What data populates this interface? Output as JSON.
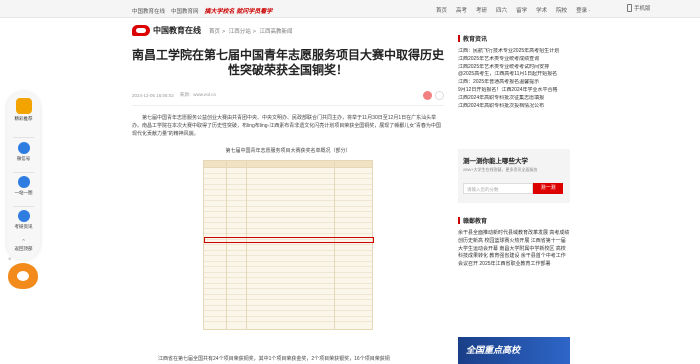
{
  "topbar": {
    "links": [
      "中国教育在线",
      "中国教育网"
    ],
    "slogan": "搞大学校名 就问学员看学",
    "nav": [
      "首页",
      "高考",
      "考研",
      "四六",
      "留学",
      "学术",
      "院校",
      "登录 ·"
    ],
    "login_icon": "mobile-icon",
    "mobile_label": "手机版"
  },
  "header": {
    "logo_text": "中国教育在线",
    "breadcrumb": [
      "首页",
      "江西分站",
      "江西高教新闻"
    ]
  },
  "left_dock": {
    "items": [
      {
        "label": "精彩推荐",
        "icon": "gift-icon"
      },
      {
        "label": "微信号",
        "icon": "wechat-icon"
      },
      {
        "label": "一站一图",
        "icon": "book-icon"
      },
      {
        "label": "考研资讯",
        "icon": "news-icon"
      },
      {
        "label": "返回顶部",
        "icon": "arrow-up-icon"
      }
    ],
    "close_label": "×"
  },
  "article": {
    "title": "南昌工学院在第七届中国青年志愿服务项目大赛中取得历史性突破荣获全国铜奖！",
    "date": "2024-12-05 16:05:02",
    "source": "来源：www.eol.cn",
    "para1": "第七届中国青年志愿服务公益创业大赛由共青团中央、中央文明办、民政部联合门共同主办，将举于11月30日至12月1日在广东汕头举办。南昌工学院在本次大赛中取得了历史性突破，布ling布ling-江西素布青非遗文化闪亮计划项目荣获全国铜奖，展现了赣鄱儿女“青春为中国现代化贡献力量”的精神风貌。",
    "caption": "第七届中国青年志愿服务项目大赛获奖名单概况（部分）",
    "lower": "江西省在第七届全国共有24个项目荣获铜奖，其中1个项目荣获金奖，2个项目荣获银奖，16个项目荣获铜"
  },
  "sidebar": {
    "heading": "教育资讯",
    "news": [
      "江西：民航飞行技术专业2025年高考招生计划",
      "江西2025年艺术类专业统考成绩查询",
      "江西2025年艺术类专业统考考试时间安排",
      "@2025高考生，江西高考11月1日起开始报名",
      "江西：2025年普通高考报名温馨提示",
      "9月12日开始报名！江西2024年学业水平合格",
      "江西2024年高职专科批次征集志愿填报",
      "江西2024年高职专科批次投档情况公布"
    ],
    "search_title": "测一测你能上哪些大学",
    "search_sub": "28W+大学生在线答疑，更多资讯全面服务",
    "search_placeholder": "请输入您的分数",
    "search_button": "测一测",
    "heading2": "赣鄱教育",
    "news2": "余干县全面推动新时代县域教育改革发展 高考成绩创历史新高 校园篮球赛火热开展 江西省第十一届大学生运动会开幕 南昌大学附属中学新校区 高校科技成果转化 教育强省建设 余干县首个中考工作会议召开 2025年江西省职业教育工作部署",
    "banner": "全国重点高校"
  }
}
